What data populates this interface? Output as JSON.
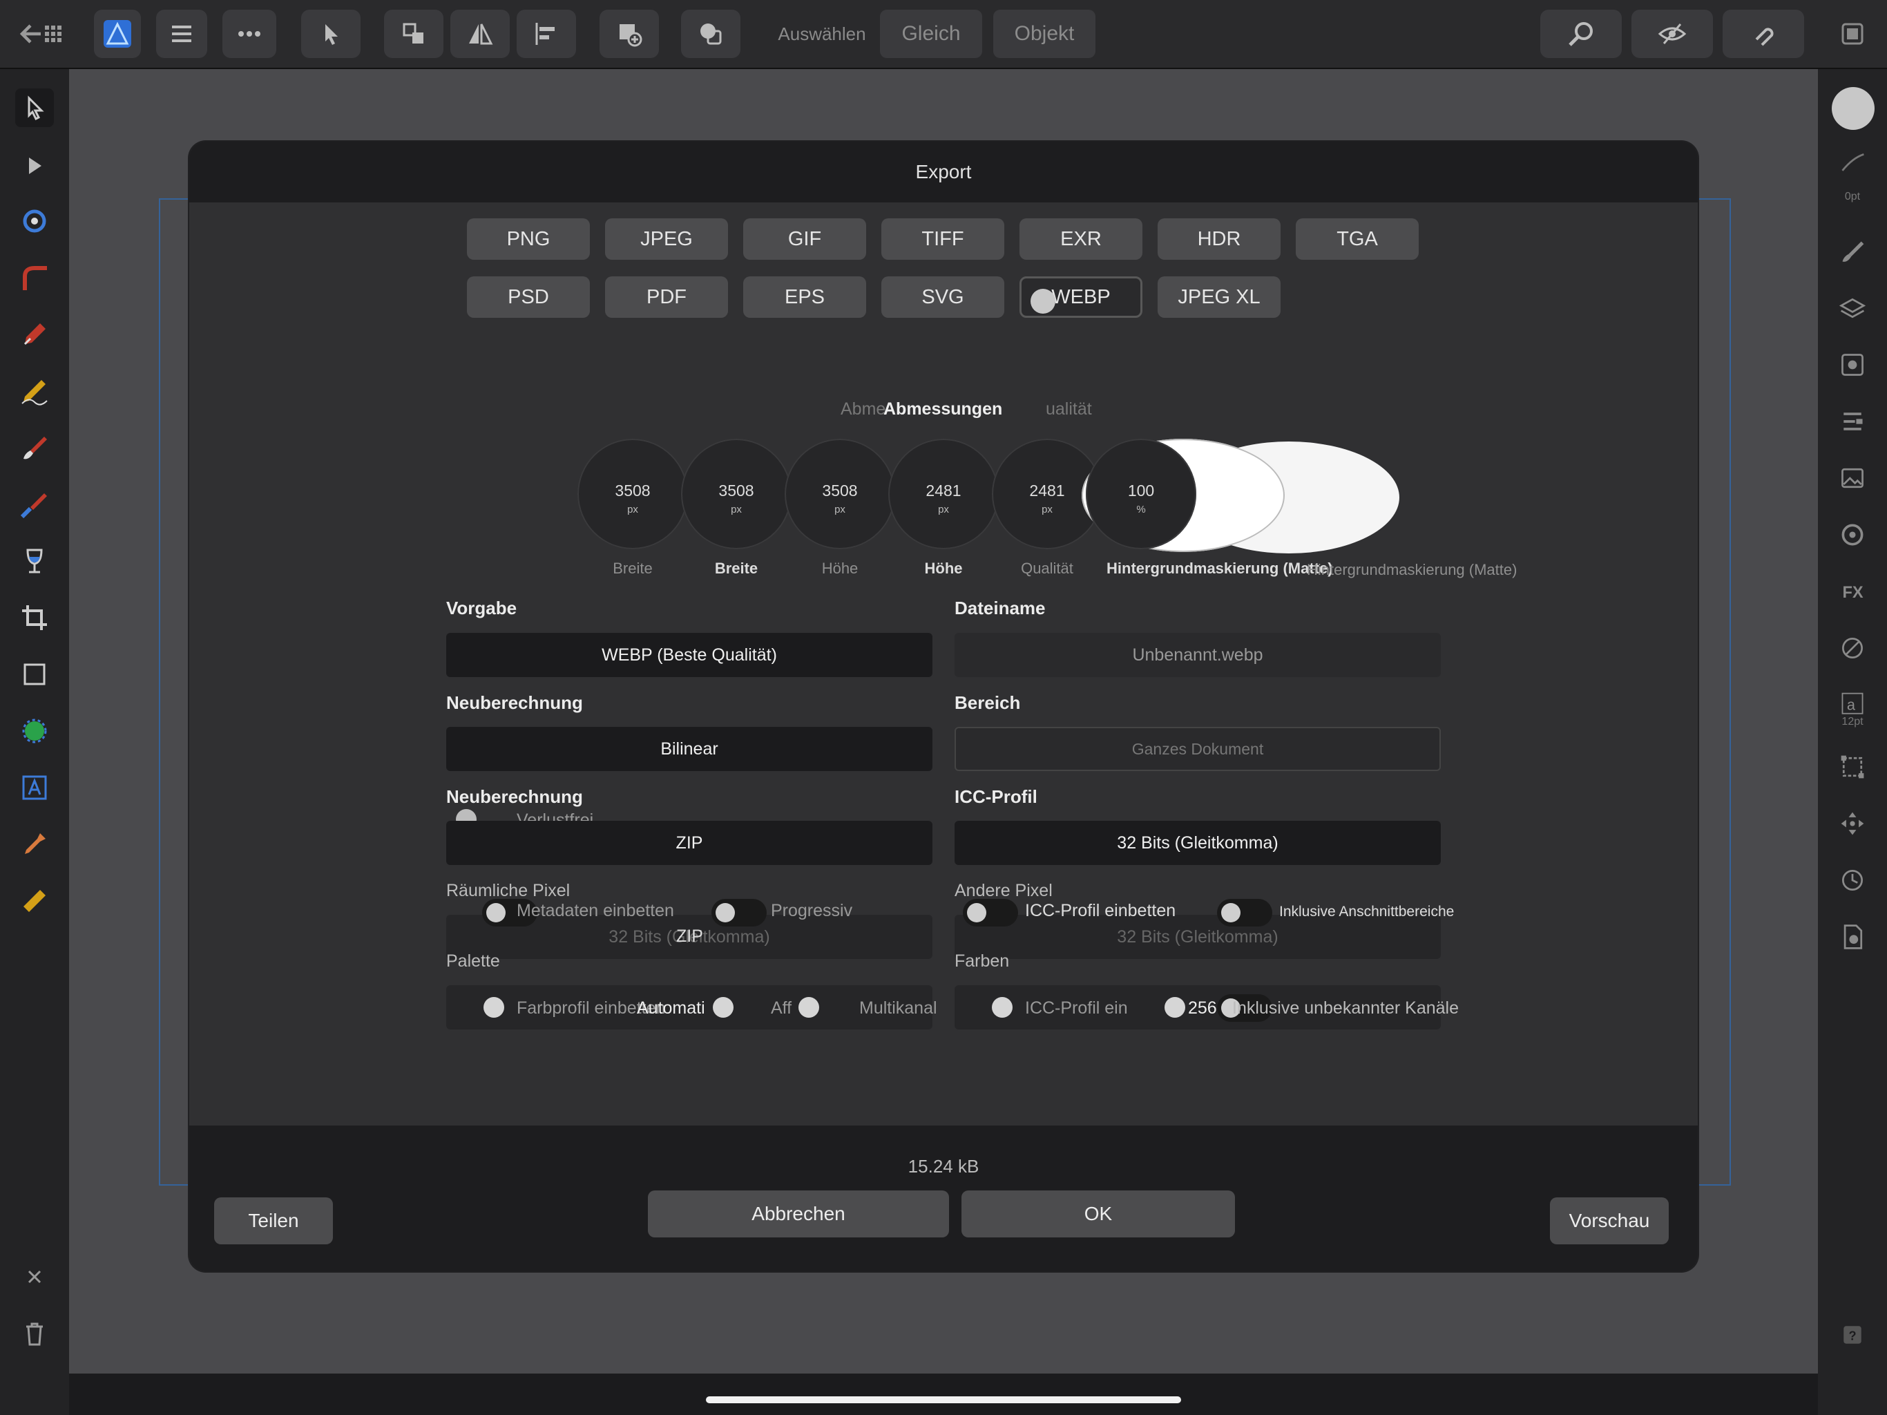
{
  "toolbar": {
    "select_label": "Auswählen",
    "same_button": "Gleich",
    "object_button": "Objekt"
  },
  "dialog": {
    "title": "Export",
    "formats_row1": [
      "PNG",
      "JPEG",
      "GIF",
      "TIFF",
      "EXR",
      "HDR",
      "TGA"
    ],
    "formats_row2": [
      "PSD",
      "PDF",
      "EPS",
      "SVG",
      "WEBP",
      "JPEG XL"
    ],
    "selected_format": "WEBP",
    "tab_header": "Abmessungen",
    "tab_ghost_left": "Abme",
    "tab_ghost_right": "ualität",
    "dials": [
      {
        "value": "3508",
        "unit": "px",
        "label": "Breite"
      },
      {
        "value": "3508",
        "unit": "px",
        "label": "Breite"
      },
      {
        "value": "3508",
        "unit": "px",
        "label": "Höhe"
      },
      {
        "value": "2481",
        "unit": "px",
        "label": "Höhe"
      },
      {
        "value": "2481",
        "unit": "px",
        "label": "Qualität"
      },
      {
        "value": "100",
        "unit": "%",
        "label": "Hintergrundmaskierung (Matte)"
      }
    ],
    "matte_label": "Hintergrundmaskierung (Matte)",
    "preset_label": "Vorgabe",
    "preset_value": "WEBP (Beste Qualität)",
    "filename_label": "Dateiname",
    "filename_value": "Unbenannt.webp",
    "resample_label": "Neuberechnung",
    "resample_value": "Bilinear",
    "area_label": "Bereich",
    "area_value": "Ganzes Dokument",
    "resample_label2": "Neuberechnung",
    "lossless_label": "Verlustfrei",
    "compression_value": "ZIP",
    "icc_label": "ICC-Profil",
    "icc_value": "32 Bits (Gleitkomma)",
    "spatial_label": "Räumliche Pixel",
    "embed_metadata": "Metadaten einbetten",
    "progressive": "Progressiv",
    "other_pixels_label": "Andere Pixel",
    "embed_icc": "ICC-Profil einbetten",
    "include_bleed": "Inklusive Anschnittbereiche",
    "ghost_bits_left": "32 Bits (Gleitkomma)",
    "ghost_zip": "ZIP",
    "ghost_bits_right": "32 Bits (Gleitkomma)",
    "palette_label": "Palette",
    "colors_label": "Farben",
    "row_left_a": "Farbprofil einbetten",
    "row_left_b": "Automati",
    "row_left_c": "Aff",
    "row_left_d": "Multikanal",
    "row_right_a": "ICC-Profil ein",
    "row_right_b": "256",
    "row_right_c": "Inklusive unbekannter Kanäle",
    "file_size": "15.24 kB",
    "share_button": "Teilen",
    "cancel_button": "Abbrechen",
    "ok_button": "OK",
    "preview_button": "Vorschau"
  },
  "right_panel": {
    "stroke_size": "0pt",
    "text_size": "12pt"
  },
  "colors": {
    "accent": "#2e6fd6",
    "dialog_bg": "#303032",
    "field_bg": "#1b1b1d"
  }
}
